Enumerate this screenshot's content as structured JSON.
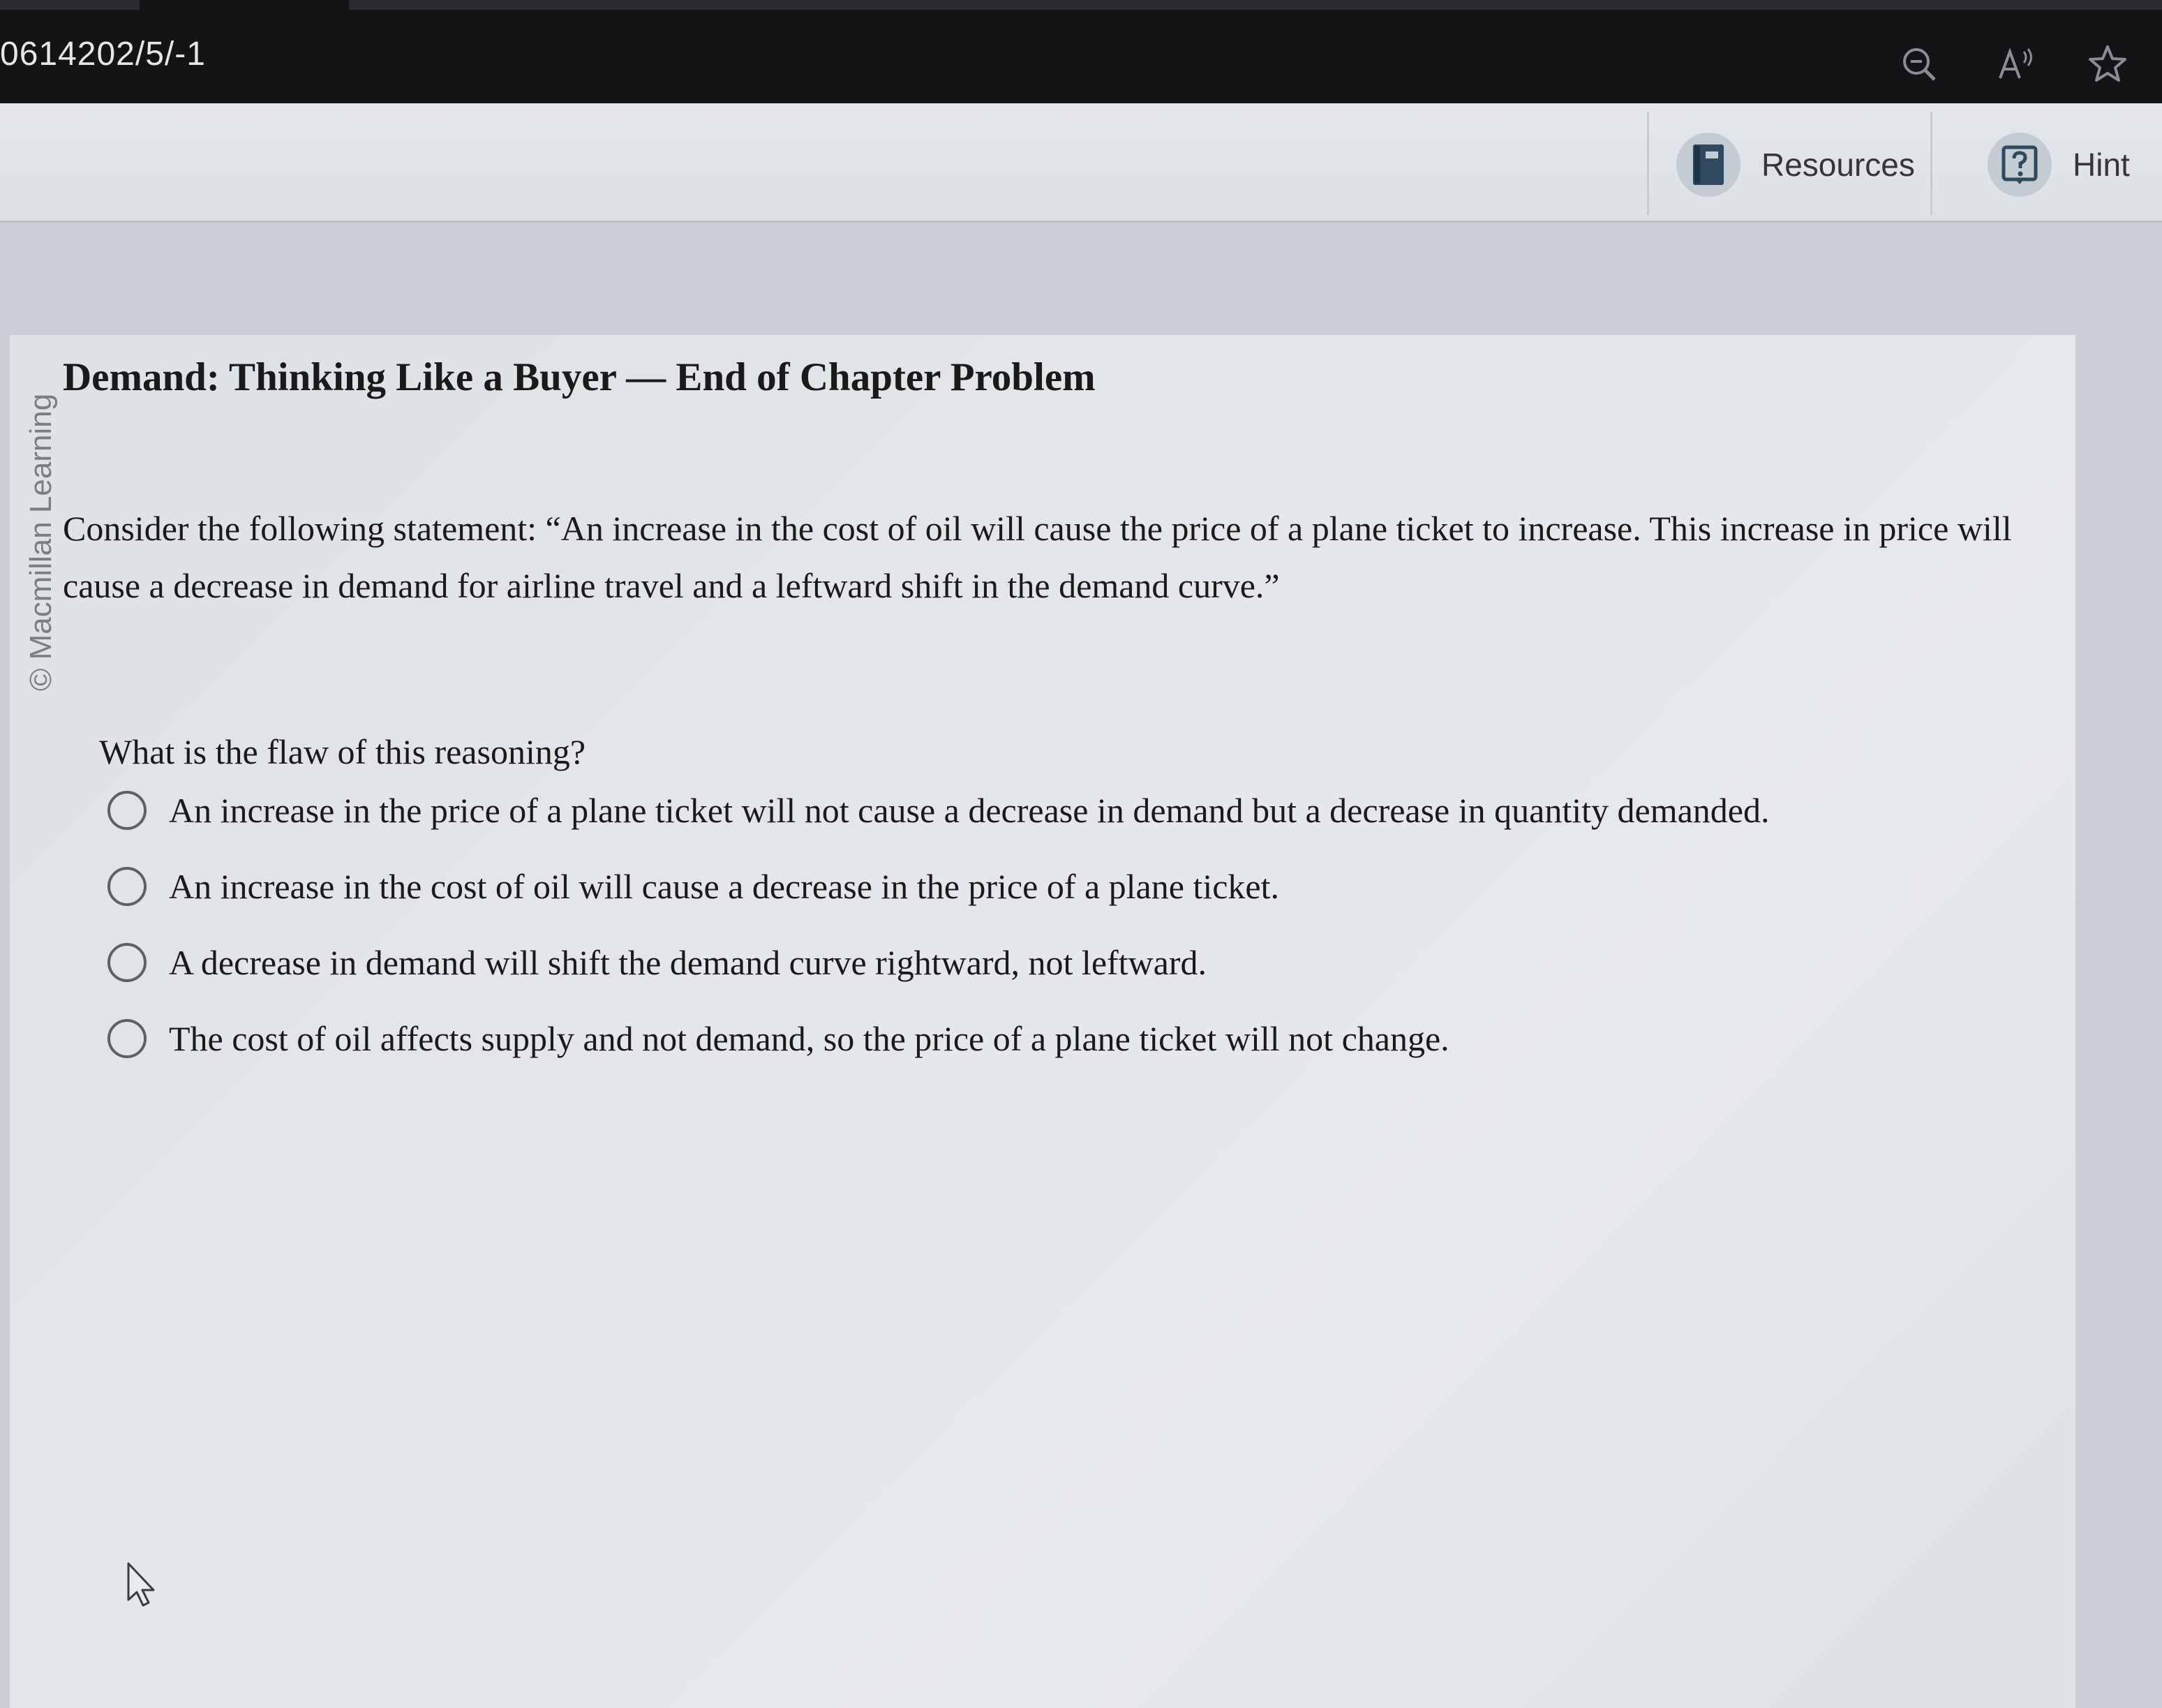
{
  "browser": {
    "url_text": "0614202/5/-1",
    "icons": [
      "zoom-out-icon",
      "read-aloud-icon",
      "favorite-star-icon"
    ],
    "zoom_out_symbol": "⊖",
    "read_aloud_symbol": "A»",
    "favorite_symbol": "☆"
  },
  "toolbar": {
    "resources_label": "Resources",
    "hint_label": "Hint",
    "icons": [
      "resources-book-icon",
      "hint-question-icon"
    ],
    "hint_icon_symbol": "?"
  },
  "copyright": "© Macmillan Learning",
  "content": {
    "title": "Demand: Thinking Like a Buyer — End of Chapter Problem",
    "statement": "Consider the following statement: “An increase in the cost of oil will cause the price of a plane ticket to increase. This increase in price will cause a decrease in demand for airline travel and a leftward shift in the demand curve.”",
    "question": "What is the flaw of this reasoning?",
    "options": [
      {
        "label": "An increase in the price of a plane ticket will not cause a decrease in demand but a decrease in quantity demanded.",
        "selected": false
      },
      {
        "label": "An increase in the cost of oil will cause a decrease in the price of a plane ticket.",
        "selected": false
      },
      {
        "label": "A decrease in demand will shift the demand curve rightward, not leftward.",
        "selected": false
      },
      {
        "label": "The cost of oil affects supply and not demand, so the price of a plane ticket will not change.",
        "selected": false
      }
    ]
  },
  "colors": {
    "top_bar": "#141416",
    "toolbar_bg": "#e0e4e7",
    "icon_accent": "#2f4a5e",
    "text": "#1a1a1a"
  }
}
